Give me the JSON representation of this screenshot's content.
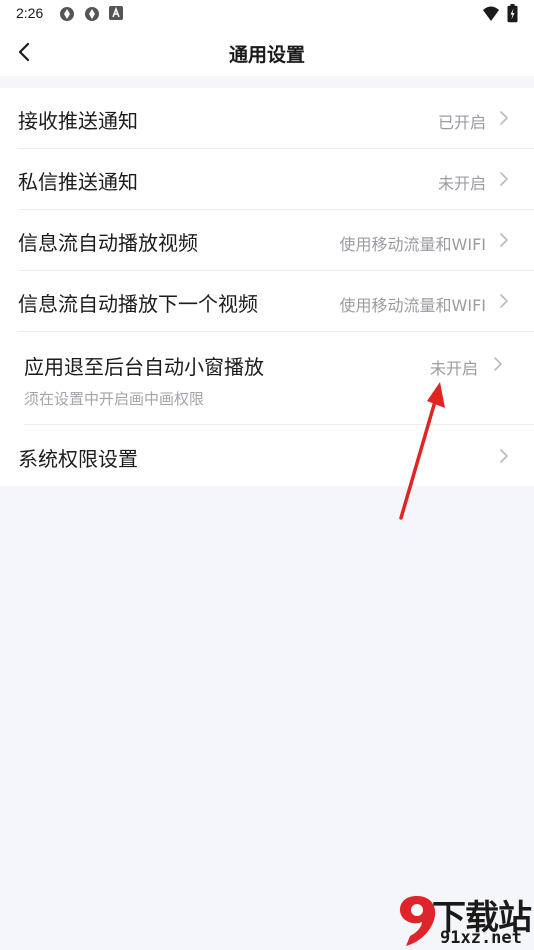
{
  "status_bar": {
    "time": "2:26",
    "icons": [
      "camera-shutter-icon",
      "camera-shutter-icon",
      "font-a-icon",
      "wifi-icon",
      "battery-charging-icon"
    ]
  },
  "header": {
    "title": "通用设置",
    "back_icon": "back-chevron-icon"
  },
  "settings": [
    {
      "label": "接收推送通知",
      "value": "已开启"
    },
    {
      "label": "私信推送通知",
      "value": "未开启"
    },
    {
      "label": "信息流自动播放视频",
      "value": "使用移动流量和WIFI"
    },
    {
      "label": "信息流自动播放下一个视频",
      "value": "使用移动流量和WIFI"
    },
    {
      "label": "应用退至后台自动小窗播放",
      "value": "未开启",
      "subtitle": "须在设置中开启画中画权限"
    },
    {
      "label": "系统权限设置",
      "value": ""
    }
  ],
  "annotation": {
    "color": "#e02424",
    "icon": "red-arrow-icon"
  },
  "watermark": {
    "name": "下载站",
    "url": "91xz.net",
    "logo_text": "9"
  },
  "colors": {
    "background": "#f5f6fa",
    "row_background": "#ffffff",
    "secondary_text": "#9a9ca3",
    "watermark_red": "#e0242b"
  }
}
